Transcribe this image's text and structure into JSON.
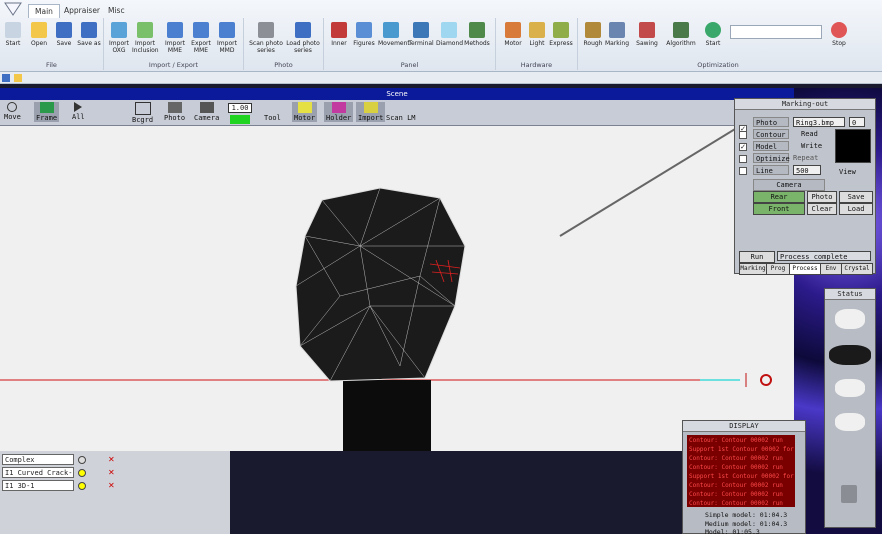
{
  "ribbon": {
    "tabs": [
      "Main",
      "Appraiser",
      "Misc"
    ],
    "groups": [
      {
        "label": "File",
        "buttons": [
          "Start",
          "Open",
          "Save",
          "Save as"
        ]
      },
      {
        "label": "Import / Export",
        "buttons": [
          "Import OXG",
          "Import Inclusion",
          "Import MME",
          "Export MME",
          "Import MMD"
        ]
      },
      {
        "label": "Photo",
        "buttons": [
          "Scan photo series",
          "Load photo series"
        ]
      },
      {
        "label": "Panel",
        "buttons": [
          "Inner",
          "Figures",
          "Movement",
          "Terminal",
          "Diamond",
          "Methods"
        ]
      },
      {
        "label": "Hardware",
        "buttons": [
          "Motor",
          "Light",
          "Express"
        ]
      },
      {
        "label": "Optimization",
        "buttons": [
          "Rough",
          "Marking",
          "Sawing",
          "Algorithm",
          "Start"
        ]
      }
    ],
    "stop_label": "Stop"
  },
  "scene": {
    "title": "Scene",
    "toolbar": [
      "Move",
      "Frame",
      "All",
      "Bcgrd",
      "Photo",
      "Camera",
      "Tool",
      "Motor",
      "Holder",
      "Import",
      "Scan LM"
    ],
    "zoom_value": "1.00"
  },
  "layers": [
    {
      "name": "Complex",
      "color": "#ffff00"
    },
    {
      "name": "I1 Curved Crack-1",
      "color": "#ffff00"
    },
    {
      "name": "I1 3D-1",
      "color": "#ffff00"
    }
  ],
  "marking": {
    "title": "Marking-out",
    "photo_label": "Photo",
    "photo_file": "Ring3.bmp",
    "photo_num": "0",
    "contour_label": "Contour",
    "read_label": "Read",
    "model_label": "Model",
    "write_label": "Write",
    "optimize_label": "Optimize",
    "repeat_label": "Repeat",
    "line_label": "Line",
    "line_value": "500",
    "view_label": "View",
    "camera_label": "Camera",
    "rear_label": "Rear",
    "front_label": "Front",
    "photo_btn": "Photo",
    "clear_btn": "Clear",
    "save_btn": "Save",
    "load_btn": "Load",
    "run_btn": "Run",
    "status_text": "Process complete",
    "tabs": [
      "Marking",
      "Prog",
      "Process",
      "Env",
      "Crystal"
    ]
  },
  "status_panel": {
    "title": "Status"
  },
  "display": {
    "title": "DISPLAY",
    "log": [
      "Contour: Contour 00002 run",
      "Support 1st Contour 00002 for",
      "Contour: Contour 00002 run",
      "Contour: Contour 00002 run",
      "Support 1st Contour 00002 for",
      "Contour: Contour 00002 run",
      "Contour: Contour 00002 run",
      "Contour: Contour 00002 run"
    ],
    "simple_model": "Simple model: 01:04.3",
    "medium_model": "Medium model: 01:04.3",
    "model_line": "Model: 01:05.3"
  }
}
